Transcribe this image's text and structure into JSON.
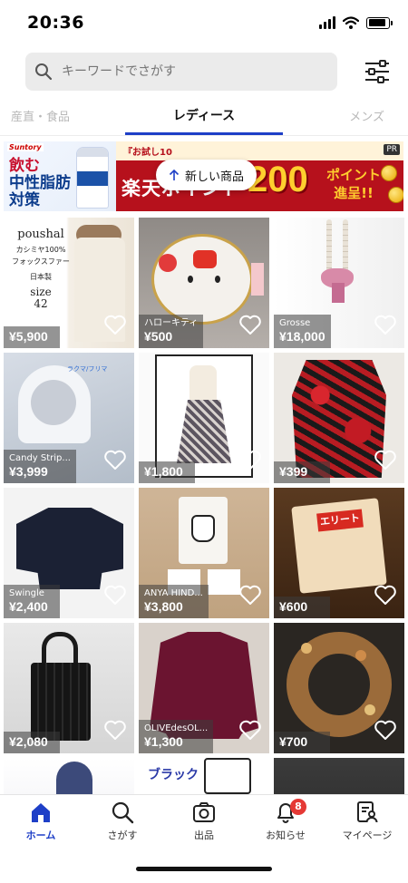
{
  "status_bar": {
    "time": "20:36",
    "battery_level": 0.9
  },
  "search": {
    "placeholder": "キーワードでさがす"
  },
  "tabs": {
    "left": "産直・食品",
    "active": "レディース",
    "right": "メンズ"
  },
  "ad": {
    "brand": "Suntory",
    "headline_1": "飲む",
    "headline_2": "中性脂肪",
    "headline_3": "対策",
    "trial_text": "『お試し10",
    "rakuten_text": "楽天ポイント",
    "points_value": "200",
    "points_text_1": "ポイント",
    "points_text_2": "進呈!!",
    "pr_label": "PR"
  },
  "new_items_label": "新しい商品",
  "products": [
    {
      "name": "",
      "price": "¥5,900"
    },
    {
      "name": "ハローキティ",
      "price": "¥500"
    },
    {
      "name": "Grosse",
      "price": "¥18,000"
    },
    {
      "name": "Candy Strip...",
      "price": "¥3,999"
    },
    {
      "name": "",
      "price": "¥1,800"
    },
    {
      "name": "",
      "price": "¥399"
    },
    {
      "name": "Swingle",
      "price": "¥2,400"
    },
    {
      "name": "ANYA HIND...",
      "price": "¥3,800"
    },
    {
      "name": "",
      "price": "¥600"
    },
    {
      "name": "",
      "price": "¥2,080"
    },
    {
      "name": "OLIVEdesOL...",
      "price": "¥1,300"
    },
    {
      "name": "",
      "price": "¥700"
    }
  ],
  "product_overlay_text": {
    "p1_line1": "poushal",
    "p1_line2": "カシミヤ100%",
    "p1_line3": "フォックスファー",
    "p1_line4": "日本製",
    "p1_line5": "size",
    "p1_line6": "42",
    "p4_caption": "ラクマ/フリマ",
    "p9_caption": "エリート",
    "p14_caption": "ブラック"
  },
  "bottom_nav": {
    "home": "ホーム",
    "search": "さがす",
    "sell": "出品",
    "notifications": "お知らせ",
    "notifications_badge": "8",
    "mypage": "マイページ"
  },
  "colors": {
    "accent": "#1e3fc7",
    "badge": "#e53935"
  }
}
